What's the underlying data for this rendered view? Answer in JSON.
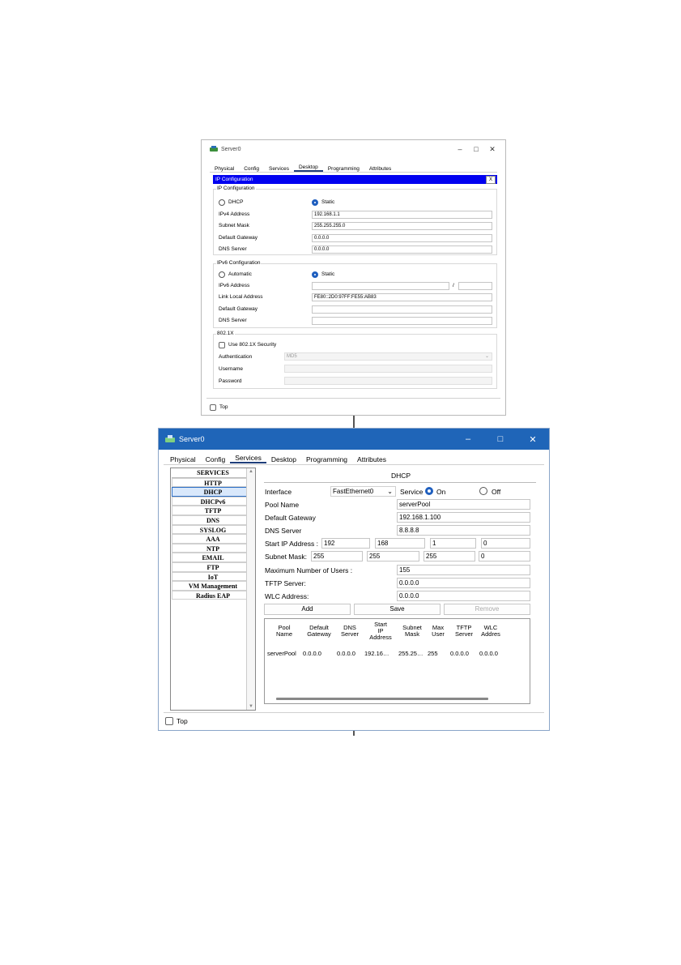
{
  "window1": {
    "title": "Server0",
    "controls": [
      "–",
      "□",
      "✕"
    ],
    "tabs": [
      "Physical",
      "Config",
      "Services",
      "Desktop",
      "Programming",
      "Attributes"
    ],
    "active_tab": "Desktop",
    "panel_title": "IP Configuration",
    "panel_close": "X",
    "ipv4": {
      "group_label": "IP Configuration",
      "dhcp_label": "DHCP",
      "static_label": "Static",
      "selected": "Static",
      "address_label": "IPv4 Address",
      "address_value": "192.168.1.1",
      "mask_label": "Subnet Mask",
      "mask_value": "255.255.255.0",
      "gateway_label": "Default Gateway",
      "gateway_value": "0.0.0.0",
      "dns_label": "DNS Server",
      "dns_value": "0.0.0.0"
    },
    "ipv6": {
      "group_label": "IPv6 Configuration",
      "automatic_label": "Automatic",
      "static_label": "Static",
      "selected": "Static",
      "address_label": "IPv6 Address",
      "address_value": "",
      "prefix_sep": "/",
      "link_local_label": "Link Local Address",
      "link_local_value": "FE80::2D0:97FF:FE55:AB83",
      "gateway_label": "Default Gateway",
      "gateway_value": "",
      "dns_label": "DNS Server",
      "dns_value": ""
    },
    "dot1x": {
      "group_label": "802.1X",
      "use_label": "Use 802.1X Security",
      "auth_label": "Authentication",
      "auth_value": "MD5",
      "username_label": "Username",
      "password_label": "Password"
    },
    "top_label": "Top"
  },
  "window2": {
    "title": "Server0",
    "controls": [
      "–",
      "□",
      "✕"
    ],
    "tabs": [
      "Physical",
      "Config",
      "Services",
      "Desktop",
      "Programming",
      "Attributes"
    ],
    "active_tab": "Services",
    "services_header": "SERVICES",
    "services": [
      "HTTP",
      "DHCP",
      "DHCPv6",
      "TFTP",
      "DNS",
      "SYSLOG",
      "AAA",
      "NTP",
      "EMAIL",
      "FTP",
      "IoT",
      "VM Management",
      "Radius EAP"
    ],
    "selected_service": "DHCP",
    "dhcp": {
      "heading": "DHCP",
      "interface_label": "Interface",
      "interface_value": "FastEthernet0",
      "service_label": "Service",
      "on_label": "On",
      "off_label": "Off",
      "service_state": "On",
      "pool_name_label": "Pool Name",
      "pool_name_value": "serverPool",
      "gateway_label": "Default Gateway",
      "gateway_value": "192.168.1.100",
      "dns_label": "DNS Server",
      "dns_value": "8.8.8.8",
      "start_ip_label": "Start IP Address :",
      "start_ip": [
        "192",
        "168",
        "1",
        "0"
      ],
      "mask_label": "Subnet Mask:",
      "mask": [
        "255",
        "255",
        "255",
        "0"
      ],
      "max_users_label": "Maximum Number of Users :",
      "max_users_value": "155",
      "tftp_label": "TFTP Server:",
      "tftp_value": "0.0.0.0",
      "wlc_label": "WLC Address:",
      "wlc_value": "0.0.0.0",
      "add_label": "Add",
      "save_label": "Save",
      "remove_label": "Remove",
      "table_headers": [
        "Pool\nName",
        "Default\nGateway",
        "DNS\nServer",
        "Start\nIP\nAddress",
        "Subnet\nMask",
        "Max\nUser",
        "TFTP\nServer",
        "WLC\nAddres"
      ],
      "table_rows": [
        [
          "serverPool",
          "0.0.0.0",
          "0.0.0.0",
          "192.16…",
          "255.25…",
          "255",
          "0.0.0.0",
          "0.0.0.0"
        ]
      ]
    },
    "top_label": "Top"
  }
}
